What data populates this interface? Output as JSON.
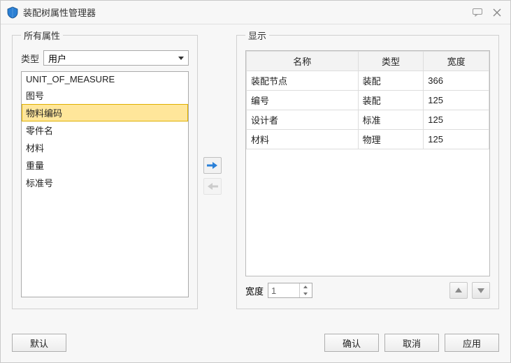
{
  "window": {
    "title": "装配树属性管理器"
  },
  "panels": {
    "all_props": {
      "legend": "所有属性",
      "type_label": "类型",
      "type_value": "用户"
    },
    "display": {
      "legend": "显示",
      "width_label": "宽度",
      "width_value": "1"
    }
  },
  "all_props_items": [
    {
      "label": "UNIT_OF_MEASURE",
      "selected": false
    },
    {
      "label": "图号",
      "selected": false
    },
    {
      "label": "物料编码",
      "selected": true
    },
    {
      "label": "零件名",
      "selected": false
    },
    {
      "label": "材料",
      "selected": false
    },
    {
      "label": "重量",
      "selected": false
    },
    {
      "label": "标准号",
      "selected": false
    }
  ],
  "display_table": {
    "headers": {
      "name": "名称",
      "type": "类型",
      "width": "宽度"
    },
    "rows": [
      {
        "name": "装配节点",
        "type": "装配",
        "width": "366"
      },
      {
        "name": "编号",
        "type": "装配",
        "width": "125"
      },
      {
        "name": "设计者",
        "type": "标准",
        "width": "125"
      },
      {
        "name": "材料",
        "type": "物理",
        "width": "125"
      }
    ]
  },
  "buttons": {
    "default": "默认",
    "ok": "确认",
    "cancel": "取消",
    "apply": "应用"
  }
}
